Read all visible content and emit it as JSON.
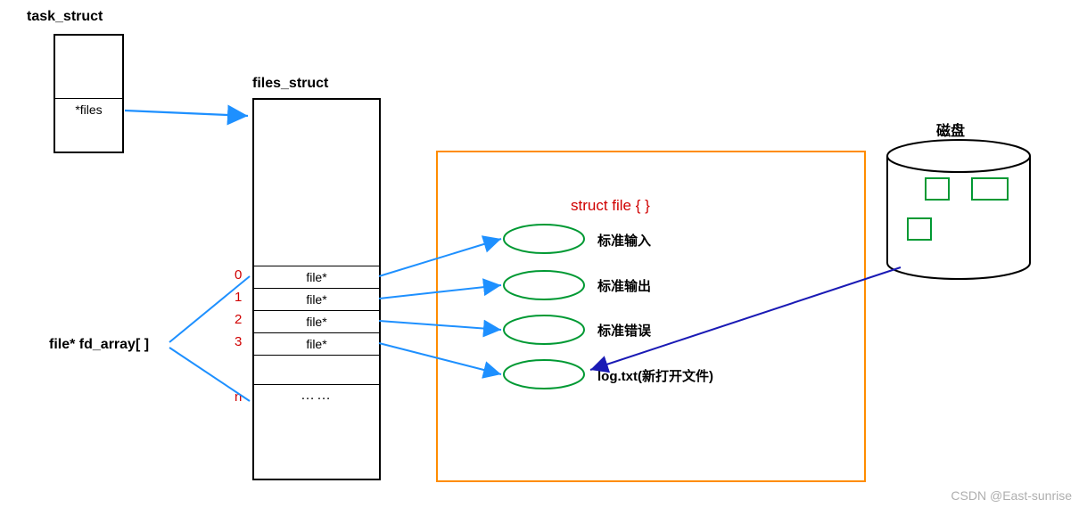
{
  "titles": {
    "task_struct": "task_struct",
    "files_struct": "files_struct",
    "disk": "磁盘"
  },
  "task_struct": {
    "files_ptr": "*files"
  },
  "fd_array_label": "file* fd_array[ ]",
  "fd_array": {
    "idx0": "0",
    "idx1": "1",
    "idx2": "2",
    "idx3": "3",
    "idxn": "n",
    "row0": "file*",
    "row1": "file*",
    "row2": "file*",
    "row3": "file*",
    "rown": "……"
  },
  "struct_file_label": "struct file { }",
  "file_labels": {
    "stdin": "标准输入",
    "stdout": "标准输出",
    "stderr": "标准错误",
    "logtxt": "log.txt(新打开文件)"
  },
  "watermark": "CSDN @East-sunrise"
}
